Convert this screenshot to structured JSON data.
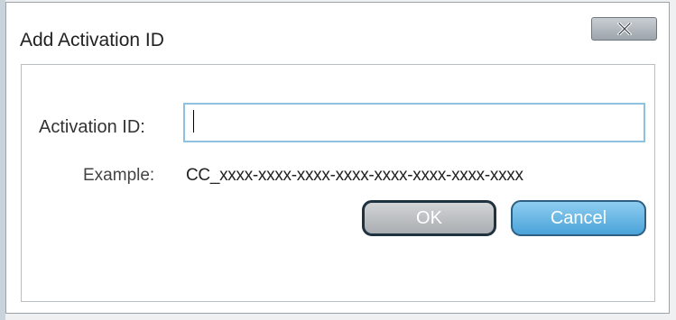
{
  "dialog": {
    "title": "Add Activation ID",
    "close_icon": "close-x-icon"
  },
  "form": {
    "activation_label": "Activation ID:",
    "activation_value": "",
    "example_label": "Example:",
    "example_value": "CC_xxxx-xxxx-xxxx-xxxx-xxxx-xxxx-xxxx-xxxx"
  },
  "buttons": {
    "ok_label": "OK",
    "cancel_label": "Cancel"
  },
  "colors": {
    "cancel_accent": "#4aa3d9",
    "input_focus_border": "#8ec1df",
    "ok_disabled": "#a9adb1"
  }
}
